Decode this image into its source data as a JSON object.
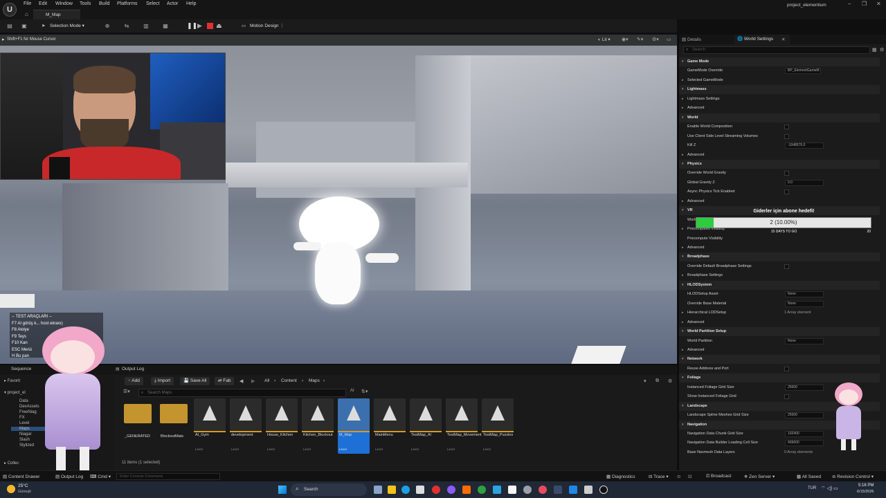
{
  "window": {
    "menu": [
      "File",
      "Edit",
      "Window",
      "Tools",
      "Build",
      "Platforms",
      "Select",
      "Actor",
      "Help"
    ],
    "tab_label": "M_Map",
    "project_name": "project_elementium"
  },
  "toolbar": {
    "selection_mode": "Selection Mode",
    "motion_design": "Motion Design"
  },
  "viewport": {
    "hint": "Shift+F1 for Mouse Cursor",
    "view_mode": "Lit"
  },
  "overlay_text": {
    "test_tools_title": "-- TEST ARAÇLARI --",
    "lines": [
      "F7  AI görüş k...",
      "F8  Atolye",
      "F9  Teys",
      "F10 Kan",
      "ESC Menü",
      "H  Bu pan"
    ],
    "f7_suffix": "host ekranı)"
  },
  "subscriber_goal": {
    "title": "Giderler için abone hedefi!",
    "count_label": "2 (10.00%)",
    "progress": 0.1,
    "days_label": "15 DAYS TO GO",
    "goal": "20",
    "bar_color": "#2ecc40"
  },
  "drawer": {
    "tabs": {
      "sequencer": "Sequence",
      "output_log": "Output Log"
    },
    "buttons": {
      "add": "Add",
      "import": "Import",
      "save_all": "Save All",
      "fab": "Fab"
    },
    "breadcrumbs": [
      "All",
      "Content",
      "Maps"
    ],
    "search_placeholder": "Search Maps",
    "tree": {
      "favorites": "Favorit",
      "project": "project_el",
      "items": [
        "Data",
        "DevAssets",
        "FreeNiag",
        "FX",
        "Level",
        "Maps",
        "Niagar",
        "Slash",
        "Stylized"
      ],
      "collections": "Collec"
    },
    "folders": [
      "_GENERATED",
      "BlockoutMats"
    ],
    "assets": [
      {
        "name": "AI_Gym",
        "type": "Level"
      },
      {
        "name": "development",
        "type": "Level"
      },
      {
        "name": "House_Kitchen",
        "type": "Level"
      },
      {
        "name": "Kitchen_Blockout",
        "type": "Level"
      },
      {
        "name": "M_Map",
        "type": "Level",
        "selected": true
      },
      {
        "name": "MainMenu",
        "type": "Level"
      },
      {
        "name": "TestMap_AI",
        "type": "Level"
      },
      {
        "name": "TestMap_Movement",
        "type": "Level"
      },
      {
        "name": "TestMap_Puzzles",
        "type": "Level"
      }
    ],
    "items_count": "11 items (1 selected)"
  },
  "details": {
    "tabs": {
      "details": "Details",
      "world_settings": "World Settings"
    },
    "search_placeholder": "Search",
    "rows": [
      {
        "kind": "cat",
        "label": "Game Mode"
      },
      {
        "kind": "prop",
        "label": "GameMode Override",
        "value": "BP_ElementGameM"
      },
      {
        "kind": "prop",
        "label": "Selected GameMode",
        "arrow": true
      },
      {
        "kind": "cat",
        "label": "Lightmass"
      },
      {
        "kind": "prop",
        "label": "Lightmass Settings",
        "arrow": true
      },
      {
        "kind": "prop",
        "label": "Advanced",
        "arrow": true
      },
      {
        "kind": "cat",
        "label": "World"
      },
      {
        "kind": "prop",
        "label": "Enable World Composition",
        "check": true
      },
      {
        "kind": "prop",
        "label": "Use Client Side Level Streaming Volumes",
        "check": true
      },
      {
        "kind": "prop",
        "label": "Kill Z",
        "value": "-1048575.0"
      },
      {
        "kind": "prop",
        "label": "Advanced",
        "arrow": true
      },
      {
        "kind": "cat",
        "label": "Physics"
      },
      {
        "kind": "prop",
        "label": "Override World Gravity",
        "check": true
      },
      {
        "kind": "prop",
        "label": "Global Gravity Z",
        "value": "0.0"
      },
      {
        "kind": "prop",
        "label": "Async Physics Tick Enabled",
        "check": true
      },
      {
        "kind": "prop",
        "label": "Advanced",
        "arrow": true
      },
      {
        "kind": "cat",
        "label": "VR"
      },
      {
        "kind": "prop",
        "label": "World"
      },
      {
        "kind": "prop",
        "label": "Precomputed Visibility",
        "arrow": true
      },
      {
        "kind": "prop",
        "label": "Precompute Visibility"
      },
      {
        "kind": "prop",
        "label": "Advanced",
        "arrow": true
      },
      {
        "kind": "cat",
        "label": "Broadphase"
      },
      {
        "kind": "prop",
        "label": "Override Default Broadphase Settings",
        "check": true
      },
      {
        "kind": "prop",
        "label": "Broadphase Settings",
        "arrow": true
      },
      {
        "kind": "cat",
        "label": "HLODSystem"
      },
      {
        "kind": "prop",
        "label": "HLODSetup Asset",
        "value": "None"
      },
      {
        "kind": "prop",
        "label": "Override Base Material",
        "value": "None"
      },
      {
        "kind": "prop",
        "label": "Hierarchical LODSetup",
        "arrow": true,
        "note": "1 Array element"
      },
      {
        "kind": "prop",
        "label": "Advanced",
        "arrow": true
      },
      {
        "kind": "cat",
        "label": "World Partition Setup"
      },
      {
        "kind": "prop",
        "label": "World Partition",
        "value": "None"
      },
      {
        "kind": "prop",
        "label": "Advanced",
        "arrow": true
      },
      {
        "kind": "cat",
        "label": "Network"
      },
      {
        "kind": "prop",
        "label": "Reuse Address and Port",
        "check": true
      },
      {
        "kind": "cat",
        "label": "Foliage"
      },
      {
        "kind": "prop",
        "label": "Instanced Foliage Grid Size",
        "value": "25600"
      },
      {
        "kind": "prop",
        "label": "Show Instanced Foliage Grid",
        "check": true
      },
      {
        "kind": "cat",
        "label": "Landscape"
      },
      {
        "kind": "prop",
        "label": "Landscape Spline Meshes Grid Size",
        "value": "25600"
      },
      {
        "kind": "cat",
        "label": "Navigation"
      },
      {
        "kind": "prop",
        "label": "Navigation Data Chunk Grid Size",
        "value": "102400"
      },
      {
        "kind": "prop",
        "label": "Navigation Data Builder Loading Cell Size",
        "value": "409600"
      },
      {
        "kind": "prop",
        "label": "Base Navmesh Data Layers",
        "note": "0 Array elements"
      }
    ]
  },
  "statusbar": {
    "content_drawer": "Content Drawer",
    "output_log": "Output Log",
    "cmd": "Cmd",
    "console_placeholder": "Enter Console Command",
    "diagnostics": "Diagnostics",
    "trace": "Trace",
    "broadcast": "Broadcast",
    "zen_server": "Zen Server",
    "all_saved": "All Saved",
    "revision_control": "Revision Control"
  },
  "taskbar": {
    "weather_temp": "25°C",
    "weather_desc": "Güneşli",
    "search": "Search",
    "lang": "TUR",
    "time": "5:16 PM",
    "date": "6/15/2026"
  }
}
